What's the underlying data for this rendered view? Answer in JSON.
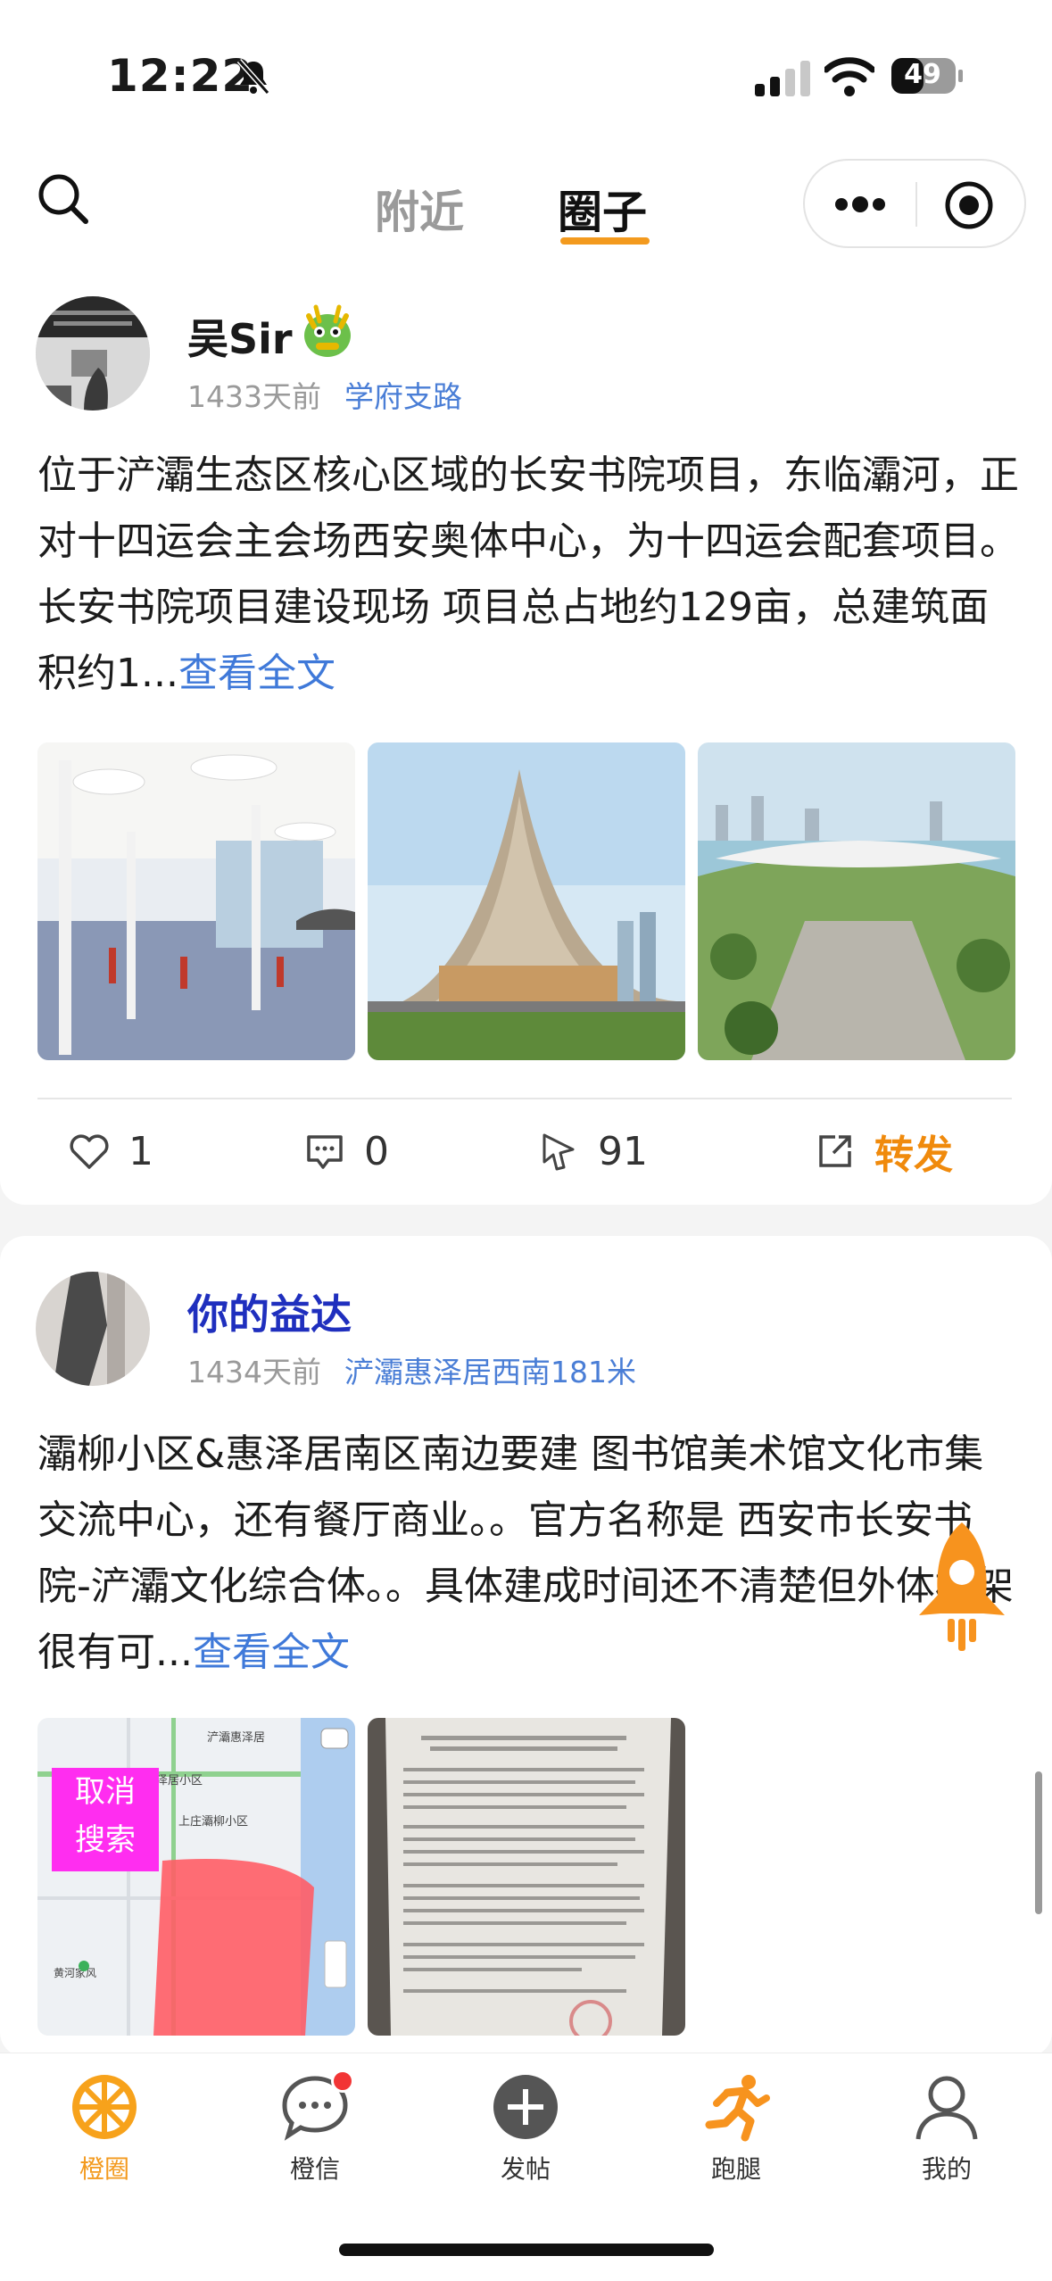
{
  "status_bar": {
    "time": "12:22",
    "battery": "49"
  },
  "nav": {
    "tab_nearby": "附近",
    "tab_circle": "圈子"
  },
  "posts": [
    {
      "username": "吴Sir",
      "days_ago": "1433天前",
      "location": "学府支路",
      "text": "位于浐灞生态区核心区域的长安书院项目，东临灞河，正对十四运会主会场西安奥体中心，为十四运会配套项目。 长安书院项目建设现场 项目总占地约129亩，总建筑面积约1...",
      "read_more": "查看全文",
      "likes": "1",
      "comments": "0",
      "views": "91",
      "share": "转发"
    },
    {
      "username": "你的益达",
      "days_ago": "1434天前",
      "location": "浐灞惠泽居西南181米",
      "text": "灞柳小区&惠泽居南区南边要建 图书馆美术馆文化市集交流中心，还有餐厅商业。。官方名称是 西安市长安书院-浐灞文化综合体。。具体建成时间还不清楚但外体框架很有可...",
      "read_more": "查看全文",
      "map_overlay": "取消\n搜索",
      "map_labels": [
        "浐灞惠泽居",
        "惠泽居小区",
        "上庄灞柳小区",
        "黄河家风"
      ]
    }
  ],
  "tabbar": [
    {
      "label": "橙圈",
      "icon": "orange-slice-icon",
      "active": true
    },
    {
      "label": "橙信",
      "icon": "chat-bubble-icon",
      "active": false
    },
    {
      "label": "发帖",
      "icon": "plus-circle-icon",
      "active": false
    },
    {
      "label": "跑腿",
      "icon": "runner-icon",
      "active": false
    },
    {
      "label": "我的",
      "icon": "user-icon",
      "active": false
    }
  ],
  "colors": {
    "accent": "#f39a1e",
    "link": "#3f79d9",
    "share": "#f08a0c"
  }
}
